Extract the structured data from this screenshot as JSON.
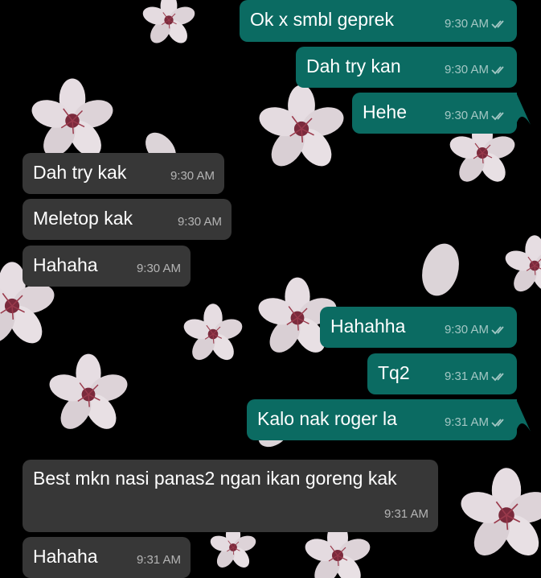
{
  "theme": {
    "incoming_bubble": "#373737",
    "outgoing_bubble": "#0b6b62",
    "background": "#000000",
    "read_tick_icon": "double-check-icon"
  },
  "messages": [
    {
      "direction": "out",
      "text": "Ok x smbl geprek",
      "time": "9:30 AM",
      "status": "read"
    },
    {
      "direction": "out",
      "text": "Dah try kan",
      "time": "9:30 AM",
      "status": "read"
    },
    {
      "direction": "out",
      "text": "Hehe",
      "time": "9:30 AM",
      "status": "read"
    },
    {
      "direction": "in",
      "text": "Dah try kak",
      "time": "9:30 AM"
    },
    {
      "direction": "in",
      "text": "Meletop kak",
      "time": "9:30 AM"
    },
    {
      "direction": "in",
      "text": "Hahaha",
      "time": "9:30 AM"
    },
    {
      "direction": "out",
      "text": "Hahahha",
      "time": "9:30 AM",
      "status": "read"
    },
    {
      "direction": "out",
      "text": "Tq2",
      "time": "9:31 AM",
      "status": "read"
    },
    {
      "direction": "out",
      "text": "Kalo nak roger la",
      "time": "9:31 AM",
      "status": "read"
    },
    {
      "direction": "in",
      "text": "Best mkn nasi panas2 ngan ikan goreng kak",
      "time": "9:31 AM"
    },
    {
      "direction": "in",
      "text": "Hahaha",
      "time": "9:31 AM"
    }
  ]
}
